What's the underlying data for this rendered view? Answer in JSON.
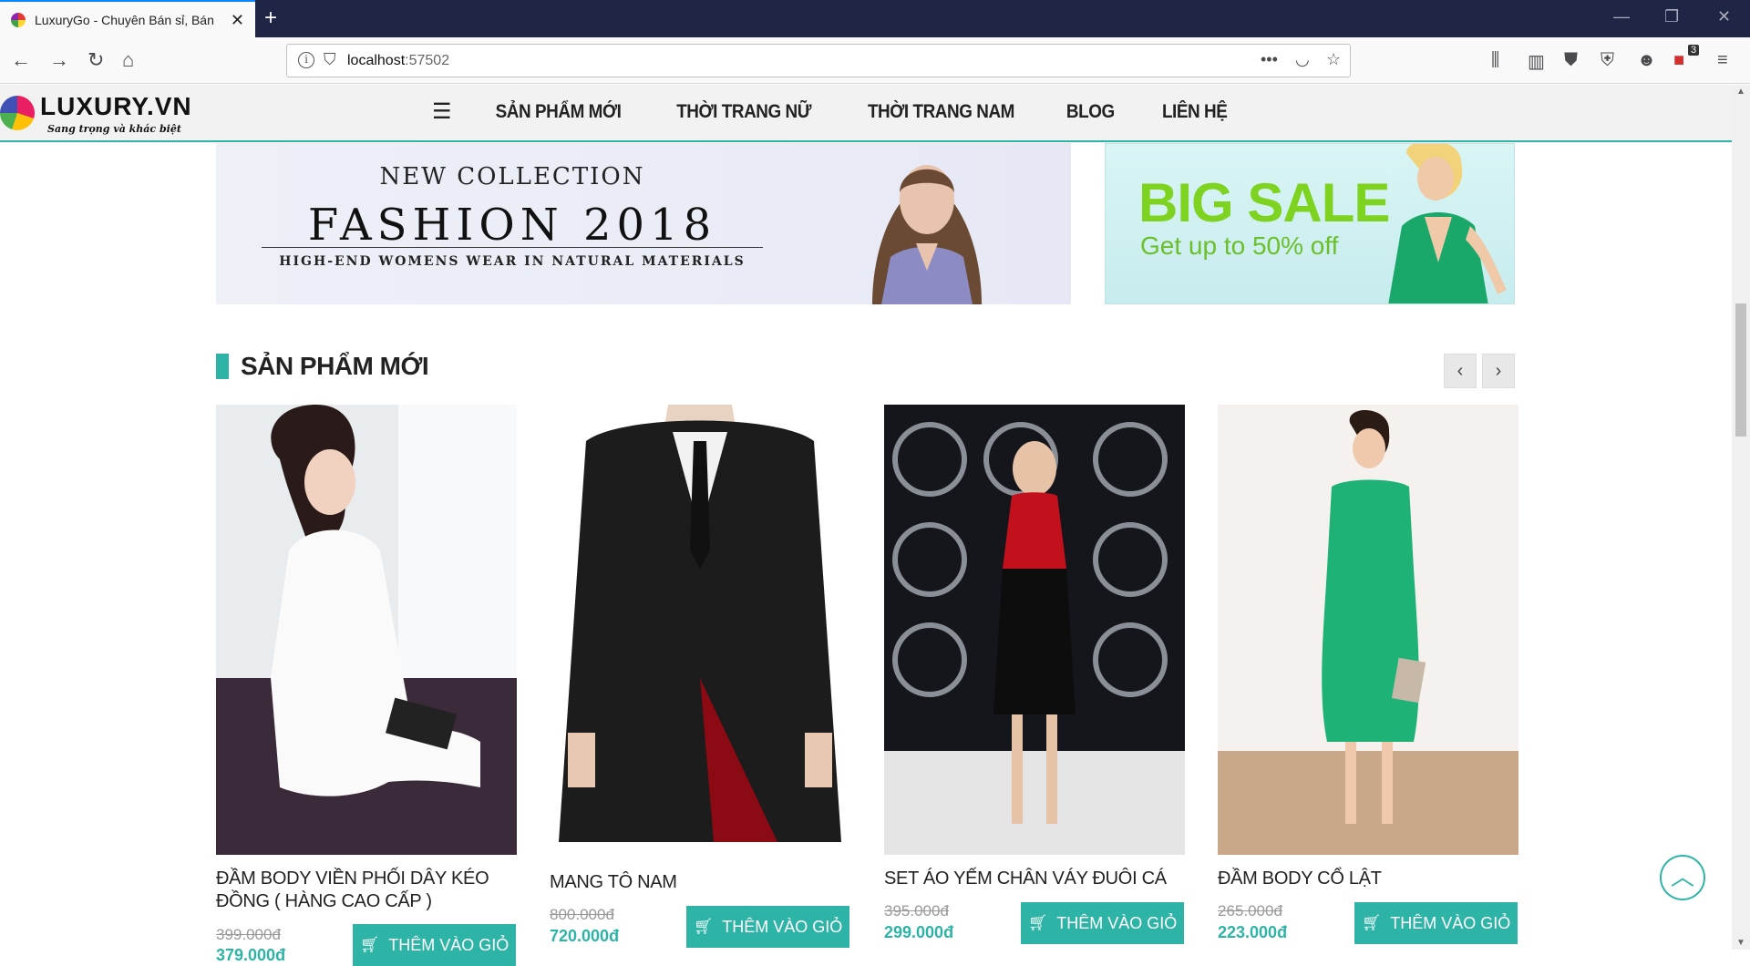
{
  "browser": {
    "tab_title": "LuxuryGo - Chuyên Bán sỉ, Bán lẻ",
    "url_host": "localhost",
    "url_port": ":57502",
    "extension_badge": "3"
  },
  "site": {
    "logo_text": "LUXURY.VN",
    "logo_tagline": "Sang trọng và khác biệt",
    "menu": [
      "SẢN PHẨM MỚI",
      "THỜI TRANG NỮ",
      "THỜI TRANG NAM",
      "BLOG",
      "LIÊN HỆ"
    ]
  },
  "banners": {
    "collection": {
      "kicker": "NEW COLLECTION",
      "title": "FASHION 2018",
      "subtitle": "HIGH-END WOMENS WEAR IN NATURAL MATERIALS"
    },
    "sale": {
      "title": "BIG SALE",
      "subtitle": "Get up to 50% off"
    }
  },
  "section": {
    "title": "SẢN PHẨM MỚI",
    "prev_icon": "chevron-left-icon",
    "next_icon": "chevron-right-icon"
  },
  "products": [
    {
      "name": "ĐẦM BODY VIỀN PHỐI DÂY KÉO ĐỒNG ( HÀNG CAO CẤP )",
      "old_price": "399.000đ",
      "new_price": "379.000đ",
      "button": "THÊM VÀO GIỎ"
    },
    {
      "name": "MANG TÔ NAM",
      "old_price": "800.000đ",
      "new_price": "720.000đ",
      "button": "THÊM VÀO GIỎ"
    },
    {
      "name": "SET ÁO YẾM CHÂN VÁY ĐUÔI CÁ",
      "old_price": "395.000đ",
      "new_price": "299.000đ",
      "button": "THÊM VÀO GIỎ"
    },
    {
      "name": "ĐẦM BODY CỔ LẬT",
      "old_price": "265.000đ",
      "new_price": "223.000đ",
      "button": "THÊM VÀO GIỎ"
    }
  ],
  "colors": {
    "accent": "#2db4a7",
    "browser_tabbar": "#1f2545"
  }
}
